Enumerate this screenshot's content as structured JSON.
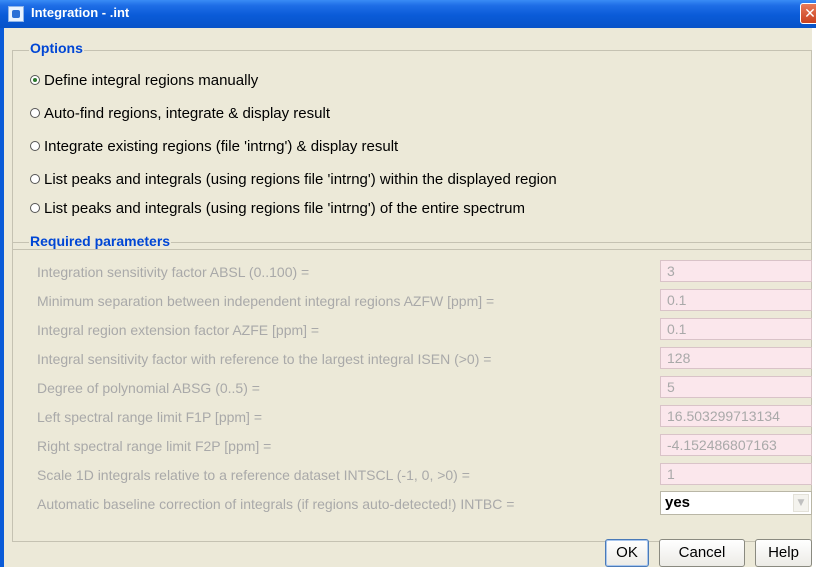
{
  "window": {
    "title": "Integration - .int",
    "close_glyph": "✕",
    "icon": "app-icon"
  },
  "options": {
    "legend": "Options",
    "items": [
      {
        "label": "Define integral regions manually",
        "selected": true
      },
      {
        "label": "Auto-find regions, integrate & display result",
        "selected": false
      },
      {
        "label": "Integrate existing regions (file 'intrng') & display result",
        "selected": false
      },
      {
        "label": "List peaks and integrals (using regions file 'intrng') within the displayed region",
        "selected": false
      },
      {
        "label": "List peaks and integrals (using regions file 'intrng') of the entire spectrum",
        "selected": false
      }
    ]
  },
  "params": {
    "legend": "Required parameters",
    "items": [
      {
        "label": "Integration sensitivity factor ABSL (0..100) =",
        "value": "3"
      },
      {
        "label": "Minimum separation between independent integral regions AZFW [ppm] =",
        "value": "0.1"
      },
      {
        "label": "Integral region extension factor AZFE [ppm] =",
        "value": "0.1"
      },
      {
        "label": "Integral sensitivity factor with reference to the largest integral ISEN (>0) =",
        "value": "128"
      },
      {
        "label": "Degree of polynomial ABSG (0..5) =",
        "value": "5"
      },
      {
        "label": "Left spectral range limit F1P [ppm] =",
        "value": "16.503299713134"
      },
      {
        "label": "Right spectral range limit F2P [ppm] =",
        "value": "-4.152486807163"
      },
      {
        "label": "Scale 1D integrals relative to a reference dataset INTSCL (-1, 0, >0) =",
        "value": "1"
      },
      {
        "label": "Automatic baseline correction of integrals (if regions auto-detected!) INTBC =",
        "value": "yes",
        "type": "select"
      }
    ]
  },
  "buttons": {
    "ok": "OK",
    "cancel": "Cancel",
    "help": "Help"
  },
  "colors": {
    "title_bar": "#0a5bd8",
    "legend_text": "#0046d5",
    "dialog_bg": "#ece9d8",
    "field_bg": "#fbe7ec",
    "disabled_text": "#a9a9a9"
  }
}
